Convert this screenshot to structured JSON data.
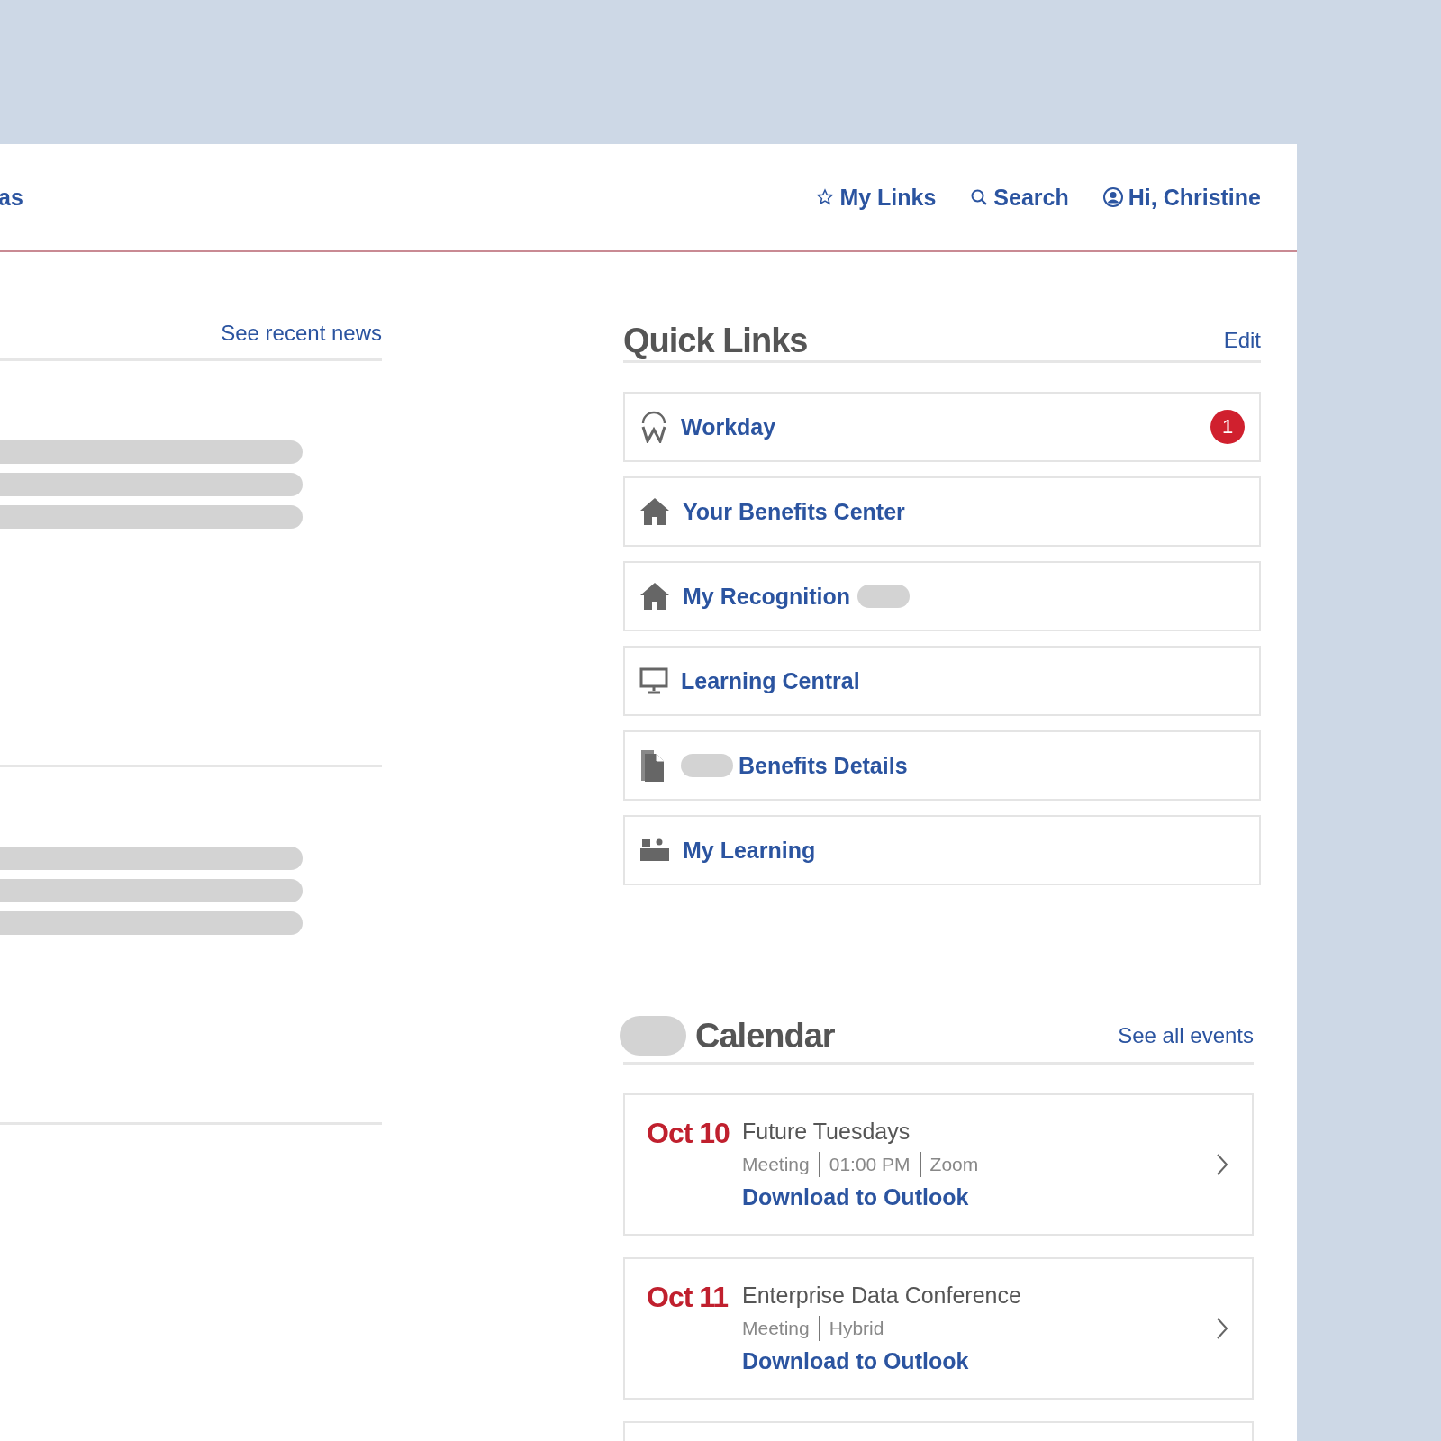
{
  "header": {
    "nav_cut_text": "as",
    "nav": [
      {
        "kind": "star",
        "label": "My Links"
      },
      {
        "kind": "search",
        "label": "Search"
      },
      {
        "kind": "user",
        "label": "Hi, Christine"
      }
    ]
  },
  "news": {
    "link": "See recent news"
  },
  "quick_links": {
    "title": "Quick Links",
    "edit": "Edit",
    "items": [
      {
        "kind": "workday",
        "label": "Workday",
        "badge": "1",
        "redacted_before": false,
        "redacted_after": false
      },
      {
        "kind": "home",
        "label": "Your Benefits Center",
        "redacted_before": false,
        "redacted_after": false
      },
      {
        "kind": "home",
        "label": "My Recognition",
        "redacted_before": false,
        "redacted_after": true
      },
      {
        "kind": "monitor",
        "label": "Learning Central",
        "redacted_before": false,
        "redacted_after": false
      },
      {
        "kind": "document",
        "label": "Benefits Details",
        "redacted_before": true,
        "redacted_after": false
      },
      {
        "kind": "desk",
        "label": "My Learning",
        "redacted_before": false,
        "redacted_after": false
      }
    ]
  },
  "calendar": {
    "title": "Calendar",
    "see_all": "See all events",
    "events": [
      {
        "date": "Oct 10",
        "title": "Future Tuesdays",
        "meta": [
          "Meeting",
          "01:00 PM",
          "Zoom"
        ],
        "download": "Download to Outlook"
      },
      {
        "date": "Oct 11",
        "title": "Enterprise Data Conference",
        "meta": [
          "Meeting",
          "Hybrid"
        ],
        "download": "Download to Outlook"
      }
    ]
  }
}
